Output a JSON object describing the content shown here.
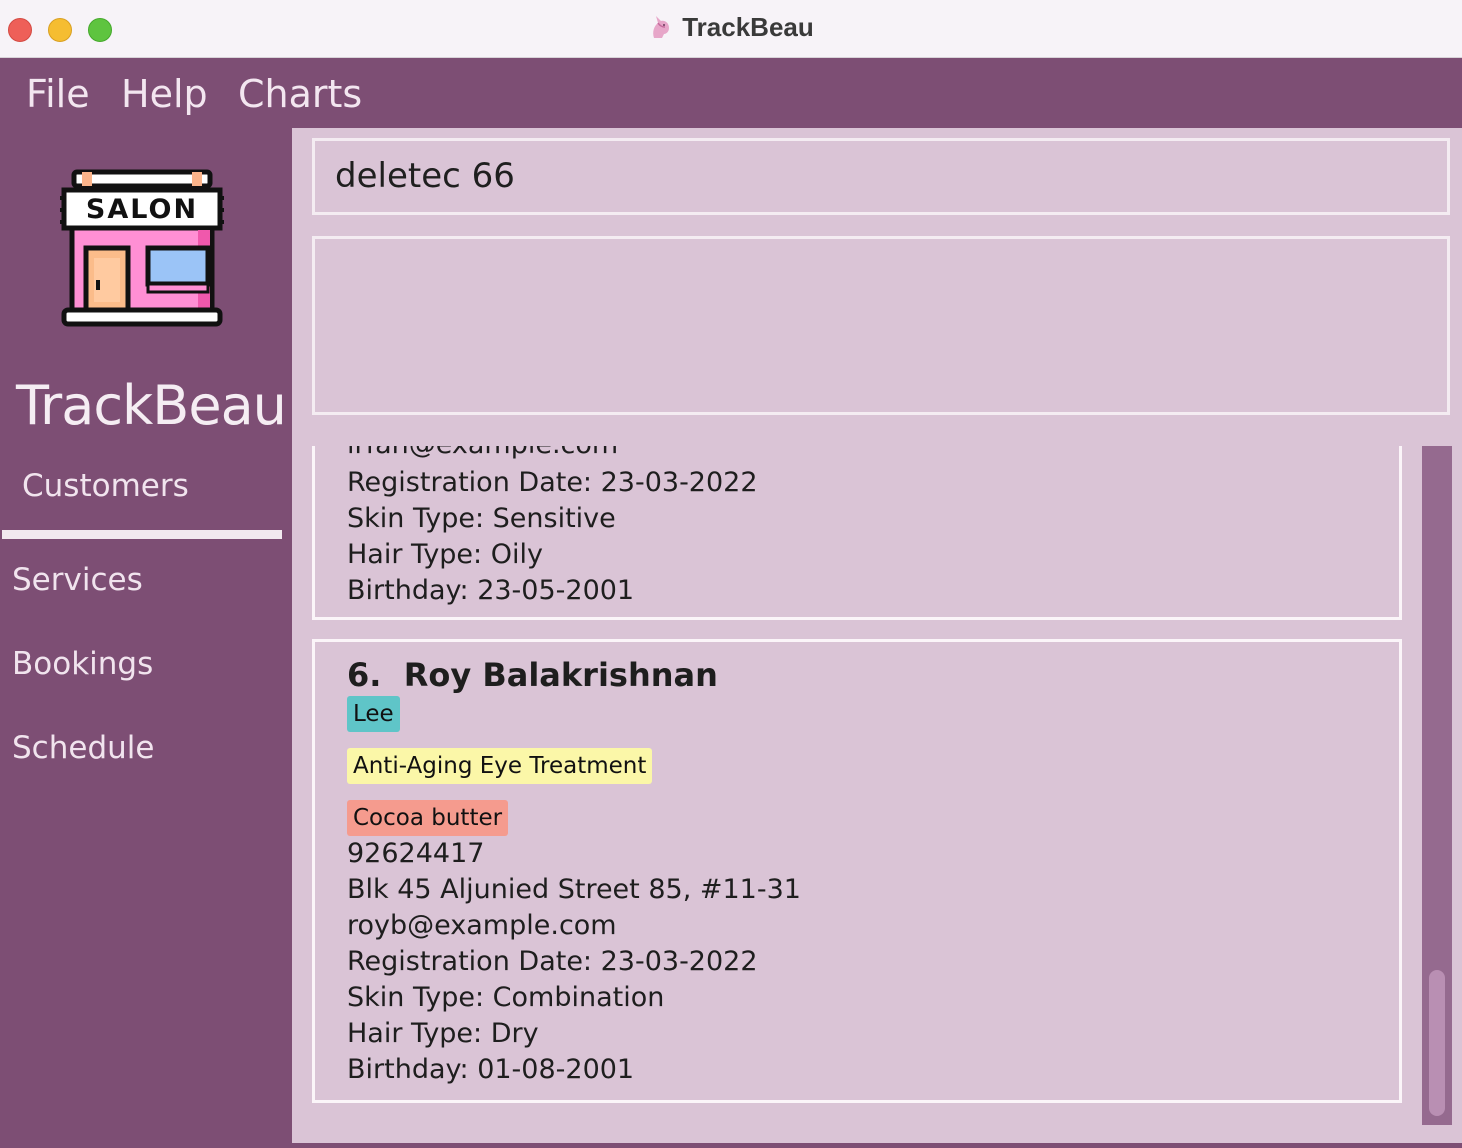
{
  "window": {
    "title": "TrackBeau"
  },
  "menubar": {
    "items": [
      "File",
      "Help",
      "Charts"
    ]
  },
  "sidebar": {
    "brand": "TrackBeau",
    "logo_text": "SALON",
    "items": [
      {
        "label": "Customers",
        "active": true
      },
      {
        "label": "Services",
        "active": false
      },
      {
        "label": "Bookings",
        "active": false
      },
      {
        "label": "Schedule",
        "active": false
      }
    ]
  },
  "command": {
    "value": "deletec 66"
  },
  "result": {
    "text": ""
  },
  "customers": [
    {
      "partial": true,
      "email": "irfan@example.com",
      "registration": "Registration Date: 23-03-2022",
      "skin": "Skin Type: Sensitive",
      "hair": "Hair Type: Oily",
      "birthday": "Birthday: 23-05-2001"
    },
    {
      "partial": false,
      "index": "6.",
      "name": "Roy Balakrishnan",
      "tags": [
        {
          "text": "Lee",
          "color": "#5fc5c8"
        },
        {
          "text": "Anti-Aging Eye Treatment",
          "color": "#fbf7a8"
        },
        {
          "text": "Cocoa butter",
          "color": "#f59b8e"
        }
      ],
      "phone": "92624417",
      "address": "Blk 45 Aljunied Street 85, #11-31",
      "email": "royb@example.com",
      "registration": "Registration Date: 23-03-2022",
      "skin": "Skin Type: Combination",
      "hair": "Hair Type: Dry",
      "birthday": "Birthday: 01-08-2001"
    }
  ],
  "colors": {
    "sidebar": "#7d4e74",
    "panel": "#dac4d6",
    "border": "#f4ecf2"
  }
}
